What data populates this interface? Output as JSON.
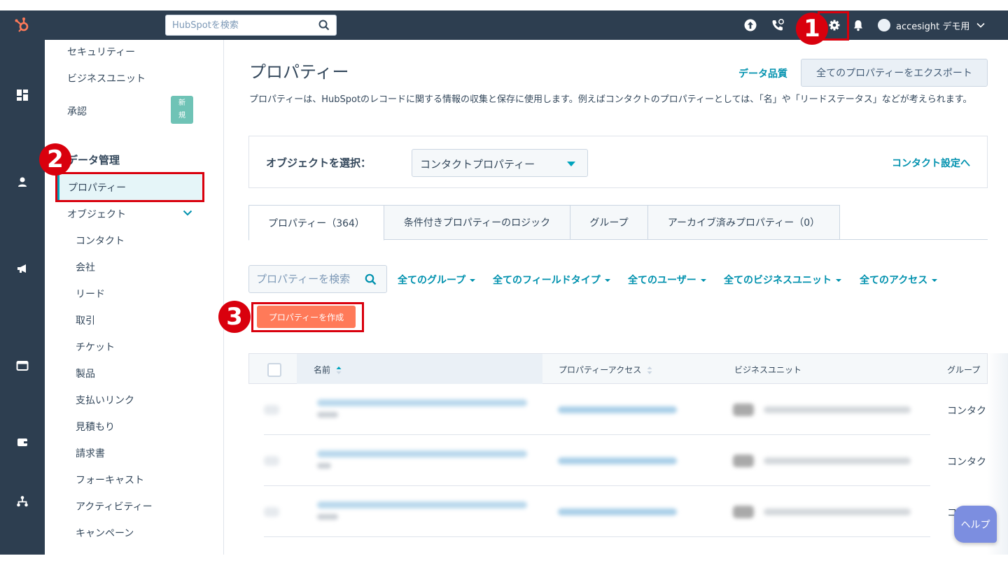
{
  "topbar": {
    "search_placeholder": "HubSpotを検索",
    "account_name": "accesight デモ用"
  },
  "callouts": [
    "1",
    "2",
    "3"
  ],
  "sidebar": {
    "items_top": [
      "セキュリティー",
      "ビジネスユニット",
      "承認"
    ],
    "new_badge": "新規",
    "section_heading": "データ管理",
    "active_item": "プロパティー",
    "objects_label": "オブジェクト",
    "object_items": [
      "コンタクト",
      "会社",
      "リード",
      "取引",
      "チケット",
      "製品",
      "支払いリンク",
      "見積もり",
      "請求書",
      "フォーキャスト",
      "アクティビティー",
      "キャンペーン"
    ]
  },
  "main": {
    "title": "プロパティー",
    "data_quality_link": "データ品質",
    "export_button": "全てのプロパティーをエクスポート",
    "description": "プロパティーは、HubSpotのレコードに関する情報の収集と保存に使用します。例えばコンタクトのプロパティーとしては、「名」や「リードステータス」などが考えられます。",
    "object_label": "オブジェクトを選択：",
    "object_selected": "コンタクトプロパティー",
    "object_settings_link": "コンタクト設定へ",
    "tabs": [
      "プロパティー（364）",
      "条件付きプロパティーのロジック",
      "グループ",
      "アーカイブ済みプロパティー（0）"
    ],
    "property_search_placeholder": "プロパティーを検索",
    "filters": [
      "全てのグループ",
      "全てのフィールドタイプ",
      "全てのユーザー",
      "全てのビジネスユニット",
      "全てのアクセス"
    ],
    "create_button": "プロパティーを作成",
    "table_headers": [
      "名前",
      "プロパティーアクセス",
      "ビジネスユニット",
      "グループ"
    ],
    "row_groups": [
      "コンタク",
      "コンタク",
      "コン"
    ]
  },
  "help_button": "ヘルプ",
  "colors": {
    "nav_bg": "#2d3e50",
    "accent": "#0091ae",
    "create_button": "#ff7a59",
    "annotation_red": "#d9000d",
    "new_badge": "#6fc3b6"
  }
}
